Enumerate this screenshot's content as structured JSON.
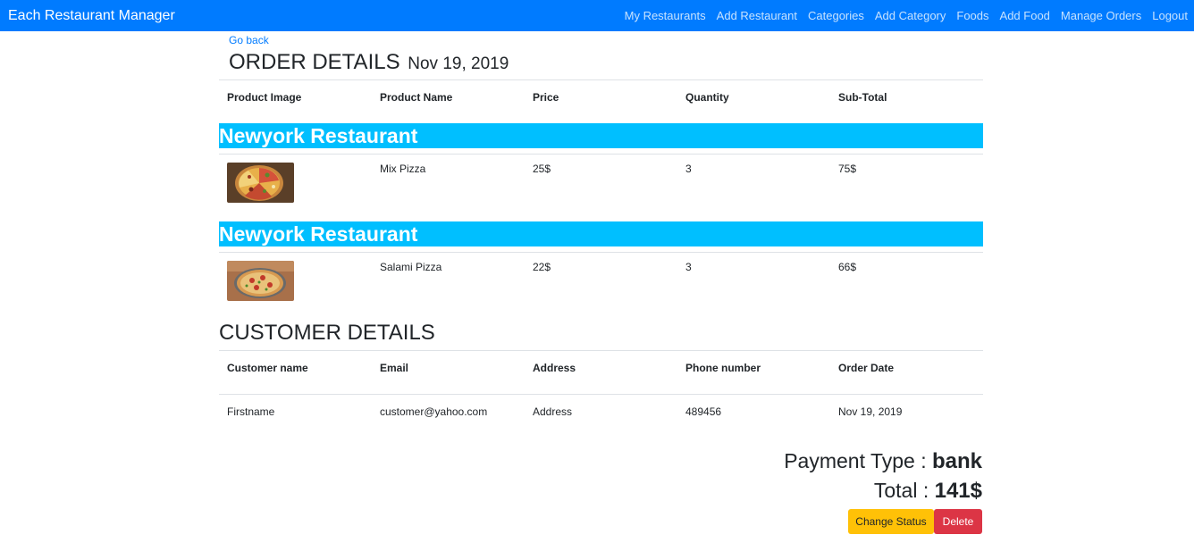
{
  "navbar": {
    "brand": "Each Restaurant Manager",
    "links": [
      "My Restaurants",
      "Add Restaurant",
      "Categories",
      "Add Category",
      "Foods",
      "Add Food",
      "Manage Orders",
      "Logout"
    ]
  },
  "order": {
    "go_back": "Go back",
    "heading": "ORDER DETAILS",
    "date": "Nov 19, 2019",
    "columns": [
      "Product Image",
      "Product Name",
      "Price",
      "Quantity",
      "Sub-Total"
    ],
    "groups": [
      {
        "restaurant": "Newyork Restaurant",
        "items": [
          {
            "image": "pizza-photo",
            "name": "Mix Pizza",
            "price": "25$",
            "quantity": "3",
            "subtotal": "75$"
          }
        ]
      },
      {
        "restaurant": "Newyork Restaurant",
        "items": [
          {
            "image": "pizza-photo",
            "name": "Salami Pizza",
            "price": "22$",
            "quantity": "3",
            "subtotal": "66$"
          }
        ]
      }
    ]
  },
  "customer": {
    "heading": "CUSTOMER DETAILS",
    "columns": [
      "Customer name",
      "Email",
      "Address",
      "Phone number",
      "Order Date"
    ],
    "row": {
      "name": "Firstname",
      "email": "customer@yahoo.com",
      "address": "Address",
      "phone": "489456",
      "order_date": "Nov 19, 2019"
    }
  },
  "summary": {
    "payment_label": "Payment Type : ",
    "payment_value": "bank",
    "total_label": "Total : ",
    "total_value": "141$"
  },
  "actions": {
    "change_status": "Change Status",
    "delete": "Delete"
  },
  "colors": {
    "navbar": "#007bff",
    "restaurant_bar": "#00bfff",
    "warning": "#ffc107",
    "danger": "#dc3545"
  }
}
